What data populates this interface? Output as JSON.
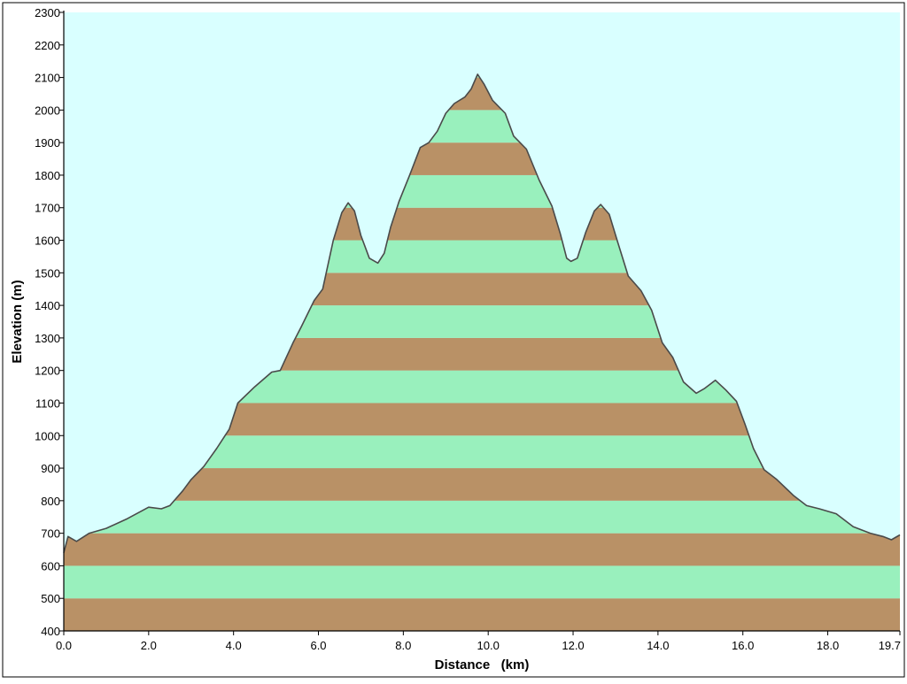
{
  "chart_data": {
    "type": "area",
    "xlabel": "Distance   (km)",
    "ylabel": "Elevation (m)",
    "xlim": [
      0.0,
      19.7
    ],
    "ylim": [
      400,
      2300
    ],
    "x_ticks": [
      0.0,
      2.0,
      4.0,
      6.0,
      8.0,
      10.0,
      12.0,
      14.0,
      16.0,
      18.0,
      19.7
    ],
    "x_tick_labels": [
      "0.0",
      "2.0",
      "4.0",
      "6.0",
      "8.0",
      "10.0",
      "12.0",
      "14.0",
      "16.0",
      "18.0",
      "19.7"
    ],
    "y_ticks": [
      400,
      500,
      600,
      700,
      800,
      900,
      1000,
      1100,
      1200,
      1300,
      1400,
      1500,
      1600,
      1700,
      1800,
      1900,
      2000,
      2100,
      2200,
      2300
    ],
    "y_tick_labels": [
      "400",
      "500",
      "600",
      "700",
      "800",
      "900",
      "1000",
      "1100",
      "1200",
      "1300",
      "1400",
      "1500",
      "1600",
      "1700",
      "1800",
      "1900",
      "2000",
      "2100",
      "2200",
      "2300"
    ],
    "band_step": 100,
    "grid": false,
    "colors": {
      "background": "#d9ffff",
      "band_dark": "#b99166",
      "band_light": "#99f0bd",
      "profile_line": "#4a4a4a"
    },
    "x": [
      0.0,
      0.1,
      0.3,
      0.6,
      1.0,
      1.5,
      2.0,
      2.3,
      2.5,
      2.8,
      3.0,
      3.3,
      3.6,
      3.9,
      4.1,
      4.5,
      4.9,
      5.1,
      5.4,
      5.6,
      5.9,
      6.1,
      6.35,
      6.55,
      6.7,
      6.85,
      7.0,
      7.2,
      7.4,
      7.55,
      7.7,
      7.9,
      8.15,
      8.4,
      8.6,
      8.8,
      9.0,
      9.2,
      9.45,
      9.6,
      9.75,
      9.9,
      10.1,
      10.4,
      10.6,
      10.9,
      11.2,
      11.5,
      11.7,
      11.85,
      11.95,
      12.1,
      12.3,
      12.5,
      12.65,
      12.85,
      13.05,
      13.3,
      13.6,
      13.85,
      14.1,
      14.35,
      14.6,
      14.9,
      15.1,
      15.35,
      15.6,
      15.85,
      16.05,
      16.25,
      16.5,
      16.8,
      17.2,
      17.5,
      17.8,
      18.2,
      18.6,
      19.0,
      19.3,
      19.5,
      19.7
    ],
    "y": [
      640,
      690,
      675,
      700,
      715,
      745,
      780,
      775,
      785,
      830,
      865,
      905,
      960,
      1020,
      1100,
      1150,
      1195,
      1200,
      1285,
      1335,
      1415,
      1450,
      1600,
      1685,
      1715,
      1690,
      1615,
      1545,
      1530,
      1560,
      1640,
      1720,
      1800,
      1885,
      1900,
      1935,
      1990,
      2020,
      2040,
      2065,
      2110,
      2080,
      2030,
      1990,
      1920,
      1880,
      1785,
      1705,
      1620,
      1545,
      1535,
      1545,
      1625,
      1690,
      1710,
      1680,
      1595,
      1490,
      1445,
      1385,
      1285,
      1240,
      1165,
      1130,
      1145,
      1170,
      1140,
      1105,
      1035,
      960,
      895,
      865,
      815,
      785,
      775,
      760,
      720,
      700,
      690,
      680,
      695
    ]
  }
}
